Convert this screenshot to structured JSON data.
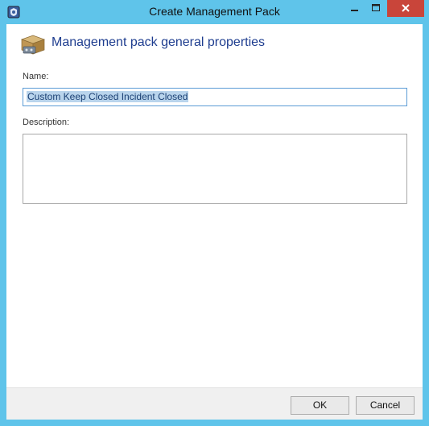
{
  "window": {
    "title": "Create Management Pack"
  },
  "header": {
    "title": "Management pack general properties",
    "icon": "package-icon"
  },
  "form": {
    "name_label": "Name:",
    "name_value": "Custom Keep Closed Incident Closed",
    "description_label": "Description:",
    "description_value": ""
  },
  "footer": {
    "ok_label": "OK",
    "cancel_label": "Cancel"
  },
  "colors": {
    "frame": "#5fc4ea",
    "close_button": "#c9453a",
    "header_text": "#1e3d8f",
    "selection": "#b9d4ec"
  }
}
